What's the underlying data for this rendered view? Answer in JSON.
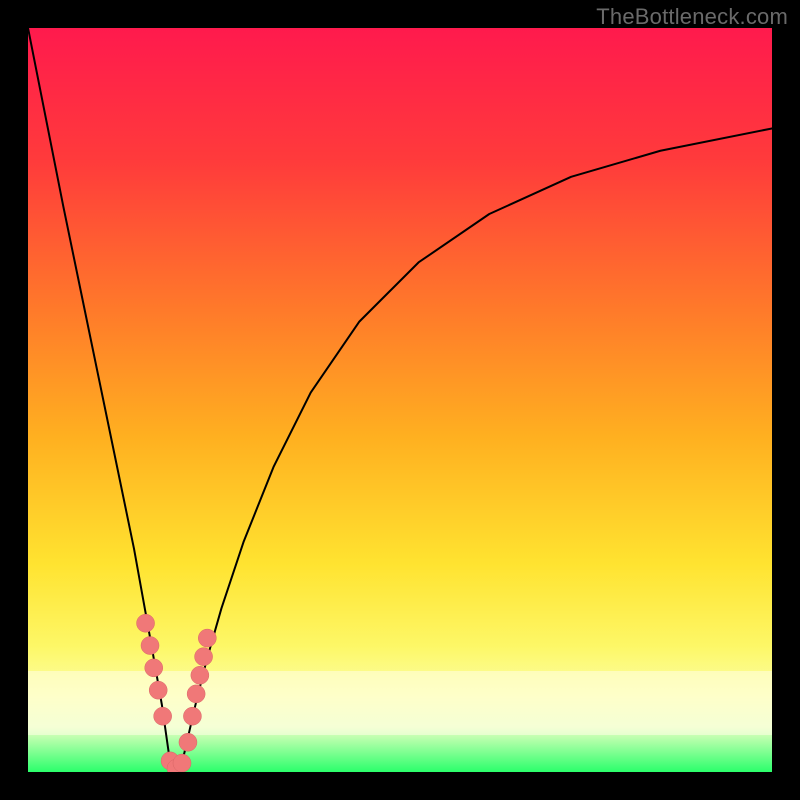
{
  "watermark": "TheBottleneck.com",
  "colors": {
    "frame": "#000000",
    "curve": "#000000",
    "marker": "#f07878",
    "marker_stroke": "#d86666",
    "gradient_top": "#ff1a4d",
    "gradient_bottom": "#2bff6b"
  },
  "chart_data": {
    "type": "line",
    "title": "",
    "xlabel": "",
    "ylabel": "",
    "xlim": [
      0,
      100
    ],
    "ylim": [
      0,
      100
    ],
    "grid": false,
    "series": [
      {
        "name": "bottleneck-curve",
        "x": [
          0.0,
          2.375,
          4.75,
          7.125,
          9.5,
          11.875,
          14.25,
          16.6,
          18.0,
          19.0,
          19.9,
          21.0,
          22.5,
          24.0,
          26.0,
          29.0,
          33.0,
          38.0,
          44.5,
          52.5,
          62.0,
          73.0,
          85.0,
          100.0
        ],
        "y": [
          100.0,
          88.0,
          76.0,
          64.5,
          53.0,
          41.5,
          30.0,
          17.0,
          9.0,
          2.0,
          0.0,
          2.5,
          9.0,
          15.0,
          22.0,
          31.0,
          41.0,
          51.0,
          60.5,
          68.5,
          75.0,
          80.0,
          83.5,
          86.5
        ]
      }
    ],
    "markers": {
      "name": "data-points",
      "x": [
        15.8,
        16.4,
        16.9,
        17.5,
        18.1,
        19.1,
        19.9,
        20.7,
        21.5,
        22.1,
        22.6,
        23.1,
        23.6,
        24.1
      ],
      "y": [
        20.0,
        17.0,
        14.0,
        11.0,
        7.5,
        1.5,
        0.5,
        1.2,
        4.0,
        7.5,
        10.5,
        13.0,
        15.5,
        18.0
      ]
    },
    "pale_band_y_range": [
      5.5,
      13.5
    ]
  }
}
